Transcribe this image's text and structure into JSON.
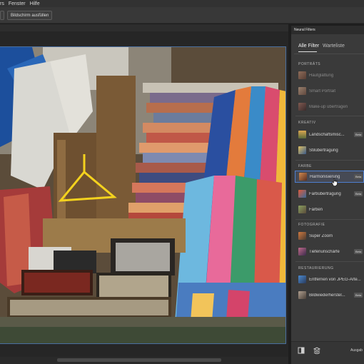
{
  "menubar": {
    "items": [
      "rs",
      "Fenster",
      "Hilfe"
    ]
  },
  "optionsbar": {
    "fullscreen_label": "Bildschirm ausfüllen"
  },
  "panel": {
    "title": "Neural Filters",
    "tabs": {
      "all": "Alle Filter",
      "waitlist": "Warteliste"
    },
    "sections": {
      "portraits": "PORTRÄTS",
      "creative": "KREATIV",
      "color": "FARBE",
      "photography": "FOTOGRAFIE",
      "restoration": "RESTAURIERUNG"
    },
    "items": {
      "skin": "Hautglättung",
      "smart_portrait": "Smart Portrait",
      "makeup": "Make-up übertragen",
      "landscape": "Landschaftsmisc...",
      "style": "Stilübertragung",
      "harmonize": "Harmonisierung",
      "color_transfer": "Farbübertragung",
      "colorize": "Färben",
      "super_zoom": "Super Zoom",
      "depth_blur": "Tiefenunschärfe",
      "jpeg": "Entfernen von JPEG-Arte...",
      "photo_restore": "Bildwiederherstel..."
    },
    "beta_label": "Beta",
    "footer_label": "Ausgab"
  },
  "colors": {
    "accent": "#4d7fcf",
    "panel_bg": "#3a3a3a",
    "workspace_bg": "#262626"
  }
}
